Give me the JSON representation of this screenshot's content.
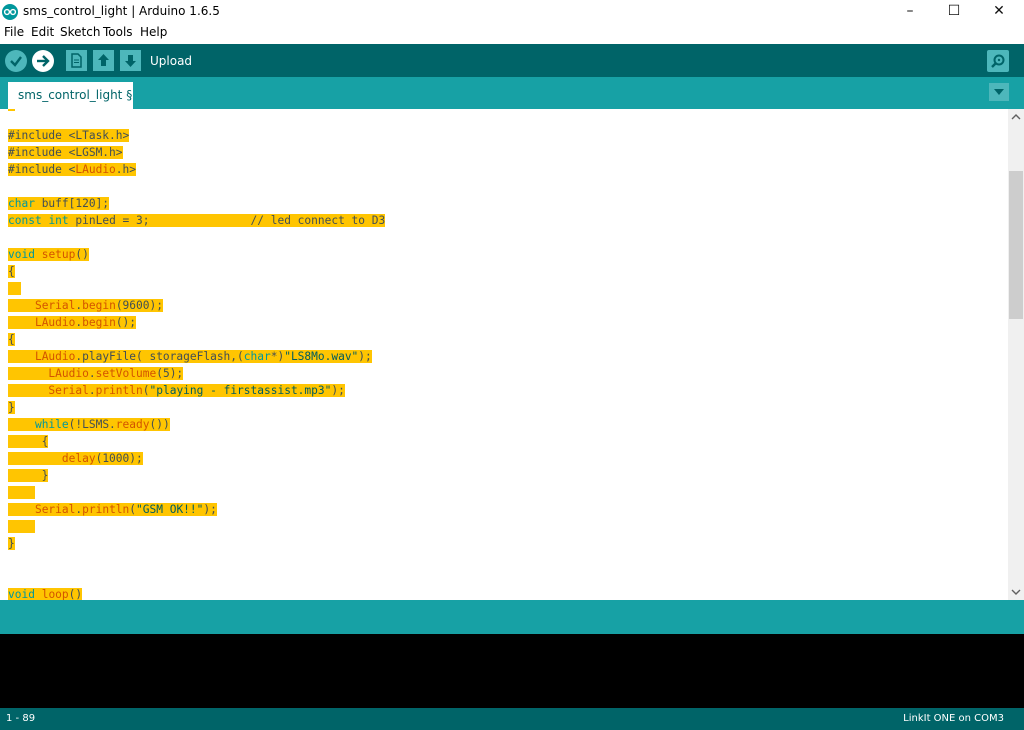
{
  "window": {
    "title": "sms_control_light | Arduino 1.6.5",
    "controls": {
      "minimize": "–",
      "maximize": "☐",
      "close": "✕"
    }
  },
  "menu": [
    "File",
    "Edit",
    "Sketch",
    "Tools",
    "Help"
  ],
  "toolbar": {
    "label": "Upload",
    "buttons": [
      "verify-icon",
      "upload-icon",
      "new-icon",
      "open-icon",
      "save-icon"
    ],
    "serial_monitor_icon": "magnifier-icon"
  },
  "tabs": [
    {
      "label": "sms_control_light §",
      "active": true
    }
  ],
  "editor": {
    "lines": [
      [
        {
          "t": "#include ",
          "c": "pp"
        },
        {
          "t": "<LTask.h>",
          "c": "pp"
        }
      ],
      [
        {
          "t": "#include ",
          "c": "pp"
        },
        {
          "t": "<LGSM.h>",
          "c": "pp"
        }
      ],
      [
        {
          "t": "#include ",
          "c": "pp"
        },
        {
          "t": "<",
          "c": "pp"
        },
        {
          "t": "LAudio",
          "c": "fn"
        },
        {
          "t": ".h>",
          "c": "pp"
        }
      ],
      [],
      [
        {
          "t": "char",
          "c": "kw"
        },
        {
          "t": " buff[120];",
          "c": "pp"
        }
      ],
      [
        {
          "t": "const",
          "c": "kw"
        },
        {
          "t": " ",
          "c": "pp"
        },
        {
          "t": "int",
          "c": "kw"
        },
        {
          "t": " pinLed = 3;               // led connect to D3",
          "c": "cm"
        }
      ],
      [],
      [
        {
          "t": "void",
          "c": "kw"
        },
        {
          "t": " ",
          "c": "pp"
        },
        {
          "t": "setup",
          "c": "fn"
        },
        {
          "t": "()",
          "c": "pp"
        }
      ],
      [
        {
          "t": "{",
          "c": "pp"
        }
      ],
      [
        {
          "t": "  ",
          "c": "pp"
        }
      ],
      [
        {
          "t": "    ",
          "c": "pp"
        },
        {
          "t": "Serial",
          "c": "fn"
        },
        {
          "t": ".",
          "c": "pp"
        },
        {
          "t": "begin",
          "c": "fn"
        },
        {
          "t": "(9600);",
          "c": "pp"
        }
      ],
      [
        {
          "t": "    ",
          "c": "pp"
        },
        {
          "t": "LAudio",
          "c": "fn"
        },
        {
          "t": ".",
          "c": "pp"
        },
        {
          "t": "begin",
          "c": "fn"
        },
        {
          "t": "();",
          "c": "pp"
        }
      ],
      [
        {
          "t": "{",
          "c": "pp"
        }
      ],
      [
        {
          "t": "    ",
          "c": "pp"
        },
        {
          "t": "LAudio",
          "c": "fn"
        },
        {
          "t": ".playFile( storageFlash,(",
          "c": "pp"
        },
        {
          "t": "char",
          "c": "kw"
        },
        {
          "t": "*)",
          "c": "pp"
        },
        {
          "t": "\"LS8Mo.wav\"",
          "c": "str"
        },
        {
          "t": ");",
          "c": "pp"
        }
      ],
      [
        {
          "t": "      ",
          "c": "pp"
        },
        {
          "t": "LAudio",
          "c": "fn"
        },
        {
          "t": ".",
          "c": "pp"
        },
        {
          "t": "setVolume",
          "c": "fn"
        },
        {
          "t": "(5);",
          "c": "pp"
        }
      ],
      [
        {
          "t": "      ",
          "c": "pp"
        },
        {
          "t": "Serial",
          "c": "fn"
        },
        {
          "t": ".",
          "c": "pp"
        },
        {
          "t": "println",
          "c": "fn"
        },
        {
          "t": "(",
          "c": "pp"
        },
        {
          "t": "\"playing - firstassist.mp3\"",
          "c": "str"
        },
        {
          "t": ");",
          "c": "pp"
        }
      ],
      [
        {
          "t": "}",
          "c": "pp"
        }
      ],
      [
        {
          "t": "    ",
          "c": "pp"
        },
        {
          "t": "while",
          "c": "kw"
        },
        {
          "t": "(!LSMS.",
          "c": "pp"
        },
        {
          "t": "ready",
          "c": "fn"
        },
        {
          "t": "())",
          "c": "pp"
        }
      ],
      [
        {
          "t": "     {",
          "c": "pp"
        }
      ],
      [
        {
          "t": "        ",
          "c": "pp"
        },
        {
          "t": "delay",
          "c": "fn"
        },
        {
          "t": "(1000);",
          "c": "pp"
        }
      ],
      [
        {
          "t": "     }",
          "c": "pp"
        }
      ],
      [
        {
          "t": "    ",
          "c": "pp"
        }
      ],
      [
        {
          "t": "    ",
          "c": "pp"
        },
        {
          "t": "Serial",
          "c": "fn"
        },
        {
          "t": ".",
          "c": "pp"
        },
        {
          "t": "println",
          "c": "fn"
        },
        {
          "t": "(",
          "c": "pp"
        },
        {
          "t": "\"GSM OK!!\"",
          "c": "str"
        },
        {
          "t": ");",
          "c": "pp"
        }
      ],
      [
        {
          "t": "    ",
          "c": "pp"
        }
      ],
      [
        {
          "t": "}",
          "c": "pp"
        }
      ],
      [],
      [],
      [
        {
          "t": "void",
          "c": "kw"
        },
        {
          "t": " ",
          "c": "pp"
        },
        {
          "t": "loop",
          "c": "fn"
        },
        {
          "t": "()",
          "c": "pp"
        }
      ]
    ]
  },
  "status": {
    "line": "1 - 89",
    "board": "LinkIt ONE on COM3"
  },
  "colors": {
    "teal_dark": "#006468",
    "teal": "#17a1a5",
    "highlight": "#ffc501"
  }
}
